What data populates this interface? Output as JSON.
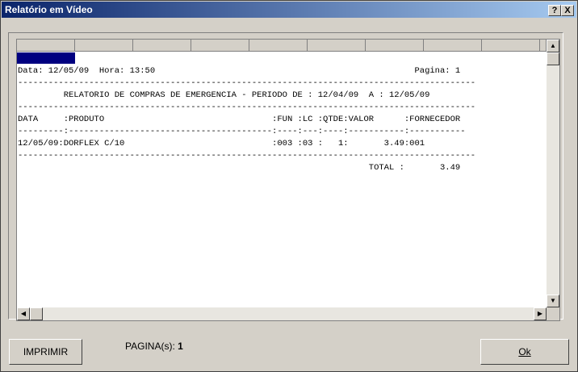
{
  "window": {
    "title": "Relatório em Vídeo",
    "help_label": "?",
    "close_label": "X"
  },
  "report": {
    "lines": [
      "Data: 12/05/09  Hora: 13:50                                                   Pagina: 1",
      "------------------------------------------------------------------------------------------",
      "         RELATORIO DE COMPRAS DE EMERGENCIA - PERIODO DE : 12/04/09  A : 12/05/09",
      "------------------------------------------------------------------------------------------",
      "DATA     :PRODUTO                                 :FUN :LC :QTDE:VALOR      :FORNECEDOR",
      "---------:----------------------------------------:----:---:----:-----------:-----------",
      "12/05/09:DORFLEX C/10                             :003 :03 :   1:       3.49:001",
      "------------------------------------------------------------------------------------------",
      "                                                                     TOTAL :       3.49"
    ]
  },
  "footer": {
    "print_button": "IMPRIMIR",
    "pages_label": "PAGINA(s):",
    "pages_value": "1",
    "ok_button": "Ok"
  }
}
